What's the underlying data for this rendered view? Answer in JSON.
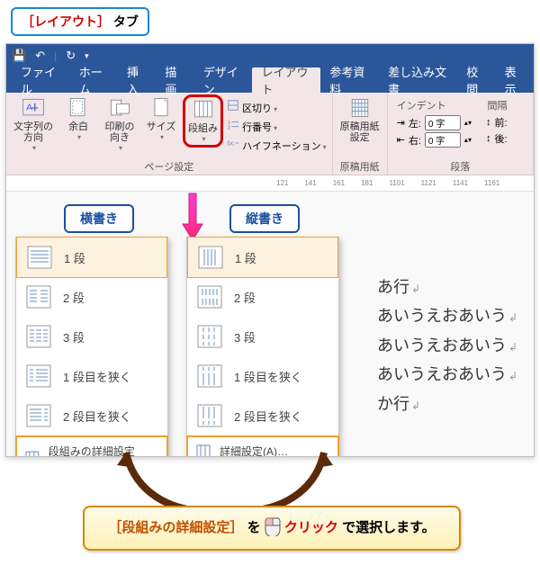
{
  "annotation": {
    "top_label_red": "［レイアウト］",
    "top_label_black": "タブ"
  },
  "qat": {
    "save": "save-icon",
    "undo": "undo-icon",
    "redo": "redo-icon"
  },
  "tabs": {
    "file": "ファイル",
    "home": "ホーム",
    "insert": "挿入",
    "draw": "描画",
    "design": "デザイン",
    "layout": "レイアウト",
    "references": "参考資料",
    "mailings": "差し込み文書",
    "review": "校閲",
    "view": "表示"
  },
  "ribbon": {
    "page_setup_label": "ページ設定",
    "manuscript_label": "原稿用紙",
    "paragraph_label": "段落",
    "text_dir": "文字列の\n方向",
    "margins": "余白",
    "orientation": "印刷の\n向き",
    "size": "サイズ",
    "columns": "段組み",
    "breaks": "区切り",
    "line_numbers": "行番号",
    "hyphenation": "ハイフネーション",
    "manuscript": "原稿用紙\n設定",
    "indent_title": "インデント",
    "spacing_title": "間隔",
    "indent_left_label": "左:",
    "indent_right_label": "右:",
    "indent_left_value": "0 字",
    "indent_right_value": "0 字",
    "before_label": "前:",
    "after_label": "後:"
  },
  "ruler_ticks": [
    "121",
    "141",
    "161",
    "181",
    "1101",
    "1121",
    "1141",
    "1161"
  ],
  "direction_labels": {
    "horizontal": "横書き",
    "vertical": "縦書き"
  },
  "columns_menu": {
    "items": [
      {
        "label": "1 段"
      },
      {
        "label": "2 段"
      },
      {
        "label": "3 段"
      },
      {
        "label": "1 段目を狭く"
      },
      {
        "label": "2 段目を狭く"
      }
    ],
    "detail_h": "段組みの詳細設定(C)…",
    "detail_v": "詳細設定(A)…"
  },
  "document": {
    "line1": "あ行",
    "line2": "あいうえおあいう",
    "line3": "あいうえおあいう",
    "line4": "あいうえおあいう",
    "line5": "か行"
  },
  "callout": {
    "part1_bracket": "［段組みの詳細設定］",
    "part2": "を",
    "part3_action": "クリック",
    "part4": "で選択します。"
  }
}
